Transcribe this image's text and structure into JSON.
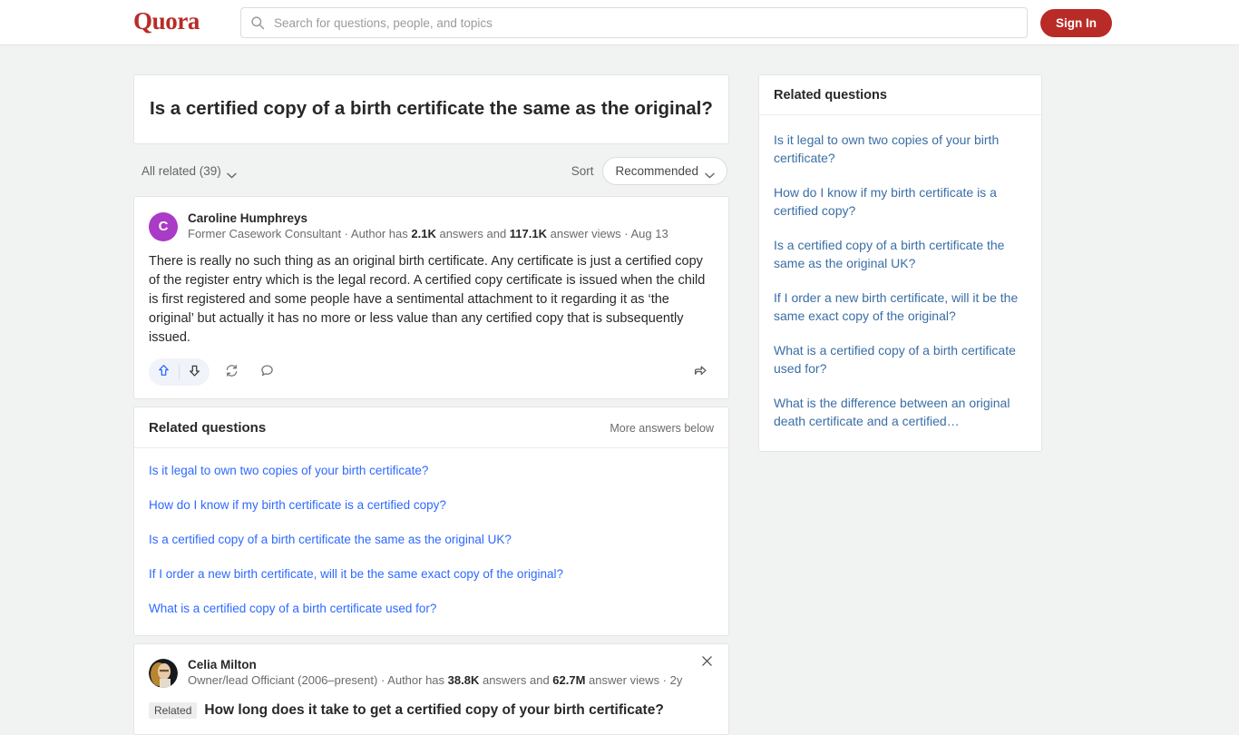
{
  "header": {
    "logo_text": "Quora",
    "search_placeholder": "Search for questions, people, and topics",
    "search_value": "",
    "signin_label": "Sign In",
    "brand_color": "#b92b27"
  },
  "question": {
    "title": "Is a certified copy of a birth certificate the same as the original?"
  },
  "filters": {
    "all_related_label": "All related (39)",
    "sort_label": "Sort",
    "sort_value": "Recommended"
  },
  "answers": [
    {
      "author_name": "Caroline Humphreys",
      "avatar_initial": "C",
      "avatar_color": "#a93bc6",
      "credential": "Former Casework Consultant",
      "answers_count": "2.1K",
      "views_count": "117.1K",
      "date": "Aug 13",
      "cred_prefix": " · Author has ",
      "cred_mid": " answers and ",
      "cred_suffix": " answer views · ",
      "body": "There is really no such thing as an original birth certificate. Any certificate is just a certified copy of the register entry which is the legal record. A certified copy certificate is issued when the child is first registered and some people have a sentimental attachment to it regarding it as ‘the original’ but actually it has no more or less value than any certified copy that is subsequently issued."
    }
  ],
  "actions": {
    "upvote_name": "upvote",
    "downvote_name": "downvote",
    "repost_name": "repost",
    "comment_name": "comment",
    "share_name": "share",
    "upvote_color": "#2e69ff"
  },
  "related_block": {
    "title": "Related questions",
    "more_label": "More answers below",
    "items": [
      "Is it legal to own two copies of your birth certificate?",
      "How do I know if my birth certificate is a certified copy?",
      "Is a certified copy of a birth certificate the same as the original UK?",
      "If I order a new birth certificate, will it be the same exact copy of the original?",
      "What is a certified copy of a birth certificate used for?"
    ]
  },
  "related_answer": {
    "author_name": "Celia Milton",
    "credential": "Owner/lead Officiant (2006–present)",
    "answers_count": "38.8K",
    "views_count": "62.7M",
    "date": "2y",
    "cred_prefix": " · Author has ",
    "cred_mid": " answers and ",
    "cred_suffix": " answer views · ",
    "badge": "Related",
    "question": "How long does it take to get a certified copy of your birth certificate?"
  },
  "sidebar": {
    "title": "Related questions",
    "items": [
      "Is it legal to own two copies of your birth certificate?",
      "How do I know if my birth certificate is a certified copy?",
      "Is a certified copy of a birth certificate the same as the original UK?",
      "If I order a new birth certificate, will it be the same exact copy of the original?",
      "What is a certified copy of a birth certificate used for?",
      "What is the difference between an original death certificate and a certified…"
    ]
  }
}
